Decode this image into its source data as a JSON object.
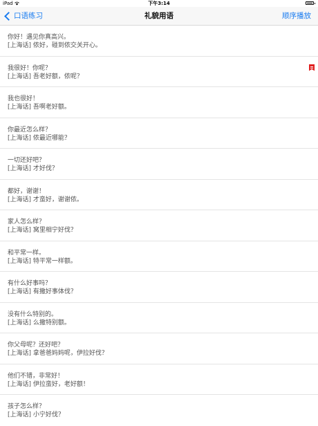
{
  "status_bar": {
    "device": "iPad",
    "wifi_icon": "wifi-icon",
    "time": "下午3:14",
    "battery_icon": "battery-icon"
  },
  "nav": {
    "back_label": "口语练习",
    "title": "礼貌用语",
    "right_label": "顺序播放"
  },
  "colors": {
    "accent": "#1a7cf0",
    "bookmark": "#e02020"
  },
  "items": [
    {
      "mandarin": "你好！遇见你真高兴。",
      "shanghai": "[上海话] 侬好，碰到侬交关开心。",
      "bookmarked": false
    },
    {
      "mandarin": "我很好！你呢？",
      "shanghai": "[上海话] 吾老好额，侬呢？",
      "bookmarked": true
    },
    {
      "mandarin": "我也很好！",
      "shanghai": "[上海话] 吾啊老好额。",
      "bookmarked": false
    },
    {
      "mandarin": "你最近怎么样？",
      "shanghai": "[上海话] 侬最近哪能？",
      "bookmarked": false
    },
    {
      "mandarin": "一切还好吧？",
      "shanghai": "[上海话] 才好伐？",
      "bookmarked": false
    },
    {
      "mandarin": "都好，谢谢！",
      "shanghai": "[上海话] 才蛮好，谢谢侬。",
      "bookmarked": false
    },
    {
      "mandarin": "家人怎么样？",
      "shanghai": "[上海话] 窝里相宁好伐？",
      "bookmarked": false
    },
    {
      "mandarin": "和平常一样。",
      "shanghai": "[上海话] 特平常一样额。",
      "bookmarked": false
    },
    {
      "mandarin": "有什么好事吗？",
      "shanghai": "[上海话] 有撒好事体伐？",
      "bookmarked": false
    },
    {
      "mandarin": "没有什么特别的。",
      "shanghai": "[上海话] 么撒特别额。",
      "bookmarked": false
    },
    {
      "mandarin": "你父母呢？还好吧？",
      "shanghai": "[上海话] 拿爸爸妈妈呢，伊拉好伐？",
      "bookmarked": false
    },
    {
      "mandarin": "他们不错，非常好！",
      "shanghai": "[上海话] 伊拉蛮好，老好额！",
      "bookmarked": false
    },
    {
      "mandarin": "孩子怎么样？",
      "shanghai": "[上海话] 小宁好伐？",
      "bookmarked": false
    }
  ]
}
